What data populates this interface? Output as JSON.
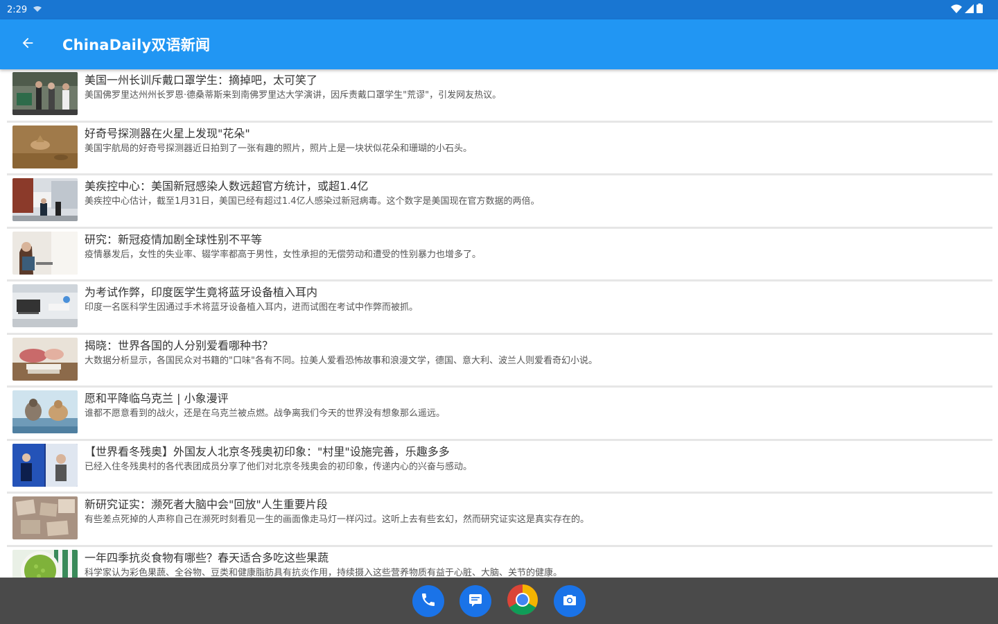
{
  "status_bar": {
    "time": "2:29"
  },
  "app_bar": {
    "title": "ChinaDaily双语新闻",
    "back_icon": "arrow-back-icon"
  },
  "articles": [
    {
      "title": "美国一州长训斥戴口罩学生：摘掉吧，太可笑了",
      "summary": "美国佛罗里达州州长罗恩·德桑蒂斯来到南佛罗里达大学演讲，因斥责戴口罩学生\"荒谬\"，引发网友热议。"
    },
    {
      "title": "好奇号探测器在火星上发现\"花朵\"",
      "summary": "美国宇航局的好奇号探测器近日拍到了一张有趣的照片，照片上是一块状似花朵和珊瑚的小石头。"
    },
    {
      "title": "美疾控中心：美国新冠感染人数远超官方统计，或超1.4亿",
      "summary": "美疾控中心估计，截至1月31日，美国已经有超过1.4亿人感染过新冠病毒。这个数字是美国现在官方数据的两倍。"
    },
    {
      "title": "研究：新冠疫情加剧全球性别不平等",
      "summary": "疫情暴发后，女性的失业率、辍学率都高于男性，女性承担的无偿劳动和遭受的性别暴力也增多了。"
    },
    {
      "title": "为考试作弊，印度医学生竟将蓝牙设备植入耳内",
      "summary": "印度一名医科学生因通过手术将蓝牙设备植入耳内，进而试图在考试中作弊而被抓。"
    },
    {
      "title": "揭晓：世界各国的人分别爱看哪种书？",
      "summary": "大数据分析显示，各国民众对书籍的\"口味\"各有不同。拉美人爱看恐怖故事和浪漫文学，德国、意大利、波兰人则爱看奇幻小说。"
    },
    {
      "title": "愿和平降临乌克兰 | 小象漫评",
      "summary": "谁都不愿意看到的战火，还是在乌克兰被点燃。战争离我们今天的世界没有想象那么遥远。"
    },
    {
      "title": "【世界看冬残奥】外国友人北京冬残奥初印象：\"村里\"设施完善，乐趣多多",
      "summary": "已经入住冬残奥村的各代表团成员分享了他们对北京冬残奥会的初印象，传递内心的兴奋与感动。"
    },
    {
      "title": "新研究证实：濒死者大脑中会\"回放\"人生重要片段",
      "summary": "有些差点死掉的人声称自己在濒死时刻看见一生的画面像走马灯一样闪过。这听上去有些玄幻，然而研究证实这是真实存在的。"
    },
    {
      "title": "一年四季抗炎食物有哪些？春天适合多吃这些果蔬",
      "summary": "科学家认为彩色果蔬、全谷物、豆类和健康脂肪具有抗炎作用，持续摄入这些营养物质有益于心脏、大脑、关节的健康。"
    }
  ],
  "dock": [
    {
      "name": "phone",
      "icon": "phone-icon"
    },
    {
      "name": "messages",
      "icon": "message-icon"
    },
    {
      "name": "chrome",
      "icon": "chrome-icon"
    },
    {
      "name": "camera",
      "icon": "camera-icon"
    }
  ],
  "colors": {
    "status_bar": "#1976d2",
    "app_bar": "#2196f3",
    "nav_bar": "#4a4a4a",
    "divider": "#e6e6e6"
  }
}
